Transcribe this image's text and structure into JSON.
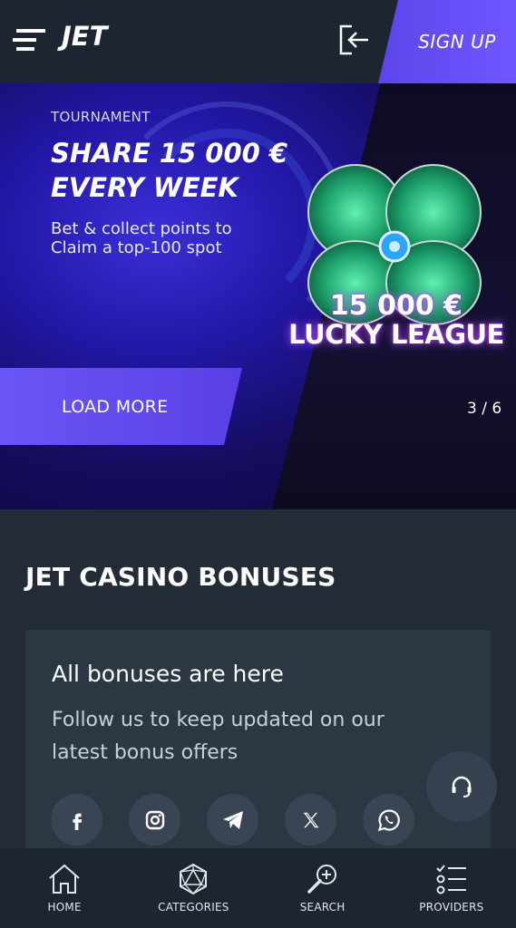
{
  "header": {
    "logo": "JET",
    "signup_label": "SIGN UP"
  },
  "banner": {
    "tag": "TOURNAMENT",
    "headline_line1": "SHARE 15 000 €",
    "headline_line2": "EVERY WEEK",
    "subtext_line1": "Bet & collect points to",
    "subtext_line2": "Claim a top-100 spot",
    "prize_amount": "15 000 €",
    "prize_name": "LUCKY LEAGUE",
    "load_more_label": "LOAD MORE",
    "pager": "3 / 6"
  },
  "bonuses": {
    "title": "JET CASINO BONUSES",
    "card_title": "All bonuses are here",
    "card_text": "Follow us to keep updated on our latest bonus offers",
    "socials": [
      "facebook-icon",
      "instagram-icon",
      "telegram-icon",
      "x-icon",
      "whatsapp-icon"
    ]
  },
  "bottom_nav": {
    "items": [
      {
        "label": "HOME",
        "icon": "home-icon"
      },
      {
        "label": "CATEGORIES",
        "icon": "categories-icon"
      },
      {
        "label": "SEARCH",
        "icon": "search-icon"
      },
      {
        "label": "PROVIDERS",
        "icon": "providers-icon"
      }
    ]
  },
  "colors": {
    "accent": "#6a55f5",
    "background": "#222b36",
    "header": "#1d2530",
    "card": "#2c3744"
  }
}
